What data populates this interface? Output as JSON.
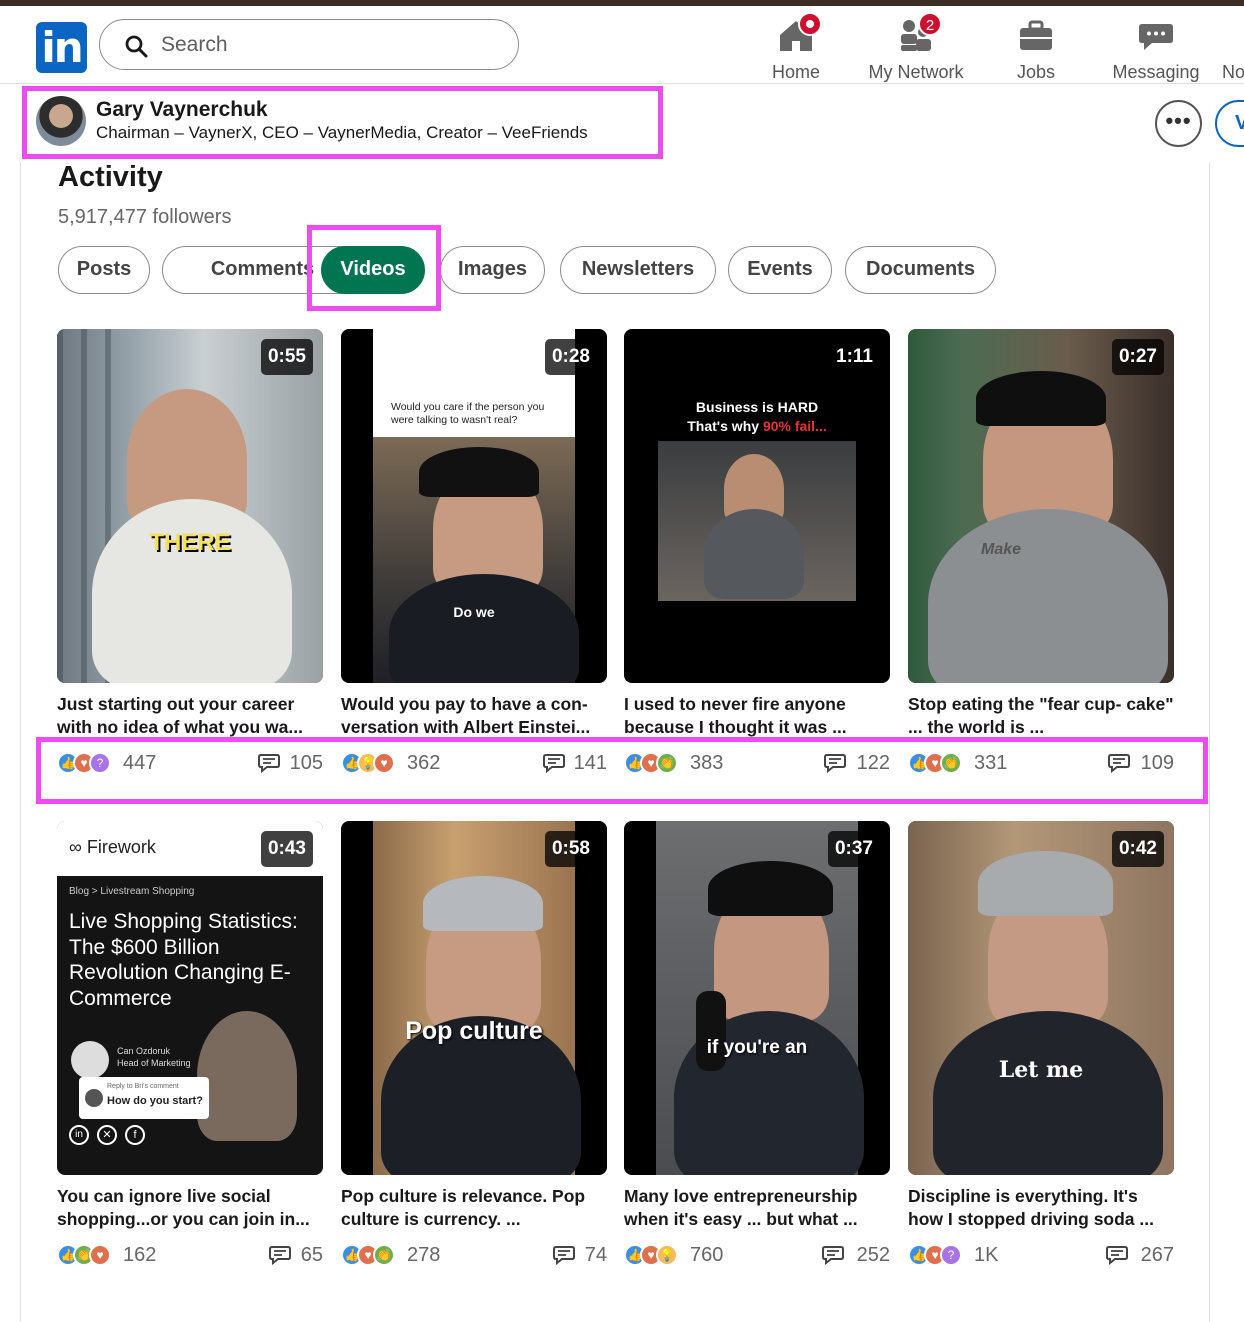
{
  "nav": {
    "logo": "in",
    "search_placeholder": "Search",
    "items": [
      {
        "label": "Home",
        "badge": ""
      },
      {
        "label": "My Network",
        "badge": "2"
      },
      {
        "label": "Jobs",
        "badge": ""
      },
      {
        "label": "Messaging",
        "badge": ""
      },
      {
        "label": "No",
        "badge": ""
      }
    ]
  },
  "profile": {
    "name": "Gary Vaynerchuk",
    "headline": "Chairman – VaynerX, CEO – VaynerMedia, Creator – VeeFriends",
    "more_label": "•••",
    "action_label": "V"
  },
  "activity": {
    "title": "Activity",
    "followers": "5,917,477 followers",
    "tabs": [
      "Posts",
      "Comments",
      "Videos",
      "Images",
      "Newsletters",
      "Events",
      "Documents"
    ],
    "active_tab": "Videos"
  },
  "videos": [
    {
      "duration": "0:55",
      "title": "Just starting out your career with no idea of what you wa...",
      "reactions": "447",
      "comments": "105",
      "overlay": "THERE",
      "reaction_types": [
        "like",
        "love",
        "curious"
      ]
    },
    {
      "duration": "0:28",
      "title": "Would you pay to have a con- versation with Albert Einstei...",
      "reactions": "362",
      "comments": "141",
      "overlay": "Do we",
      "caption_top": "Would you care if the person you were talking to wasn't real?",
      "reaction_types": [
        "like",
        "insight",
        "love"
      ]
    },
    {
      "duration": "1:11",
      "title": "I used to never fire anyone because I thought it was ...",
      "reactions": "383",
      "comments": "122",
      "caption_top": "Business is HARD",
      "caption_top2": "That's why ",
      "caption_red": "90% fail...",
      "reaction_types": [
        "like",
        "love",
        "celebrate"
      ]
    },
    {
      "duration": "0:27",
      "title": "Stop eating the \"fear cup- cake\" ... the world is ...",
      "reactions": "331",
      "comments": "109",
      "overlay": "Make",
      "reaction_types": [
        "like",
        "love",
        "celebrate"
      ]
    },
    {
      "duration": "0:43",
      "title": "You can ignore live social shopping...or you can join in...",
      "reactions": "162",
      "comments": "65",
      "fw_logo": "Firework",
      "fw_crumb": "Blog  >  Livestream Shopping",
      "fw_title": "Live Shopping Statistics: The $600 Billion Revolution Changing E-Commerce",
      "fw_author": "Can Ozdoruk",
      "fw_role": "Head of Marketing",
      "fw_reply": "Reply to Bri's comment",
      "fw_question": "How do you start?",
      "reaction_types": [
        "like",
        "celebrate",
        "love"
      ]
    },
    {
      "duration": "0:58",
      "title": "Pop culture is relevance. Pop culture is currency. ...",
      "reactions": "278",
      "comments": "74",
      "overlay": "Pop culture",
      "reaction_types": [
        "like",
        "love",
        "celebrate"
      ]
    },
    {
      "duration": "0:37",
      "title": "Many love entrepreneurship when it's easy ... but what ...",
      "reactions": "760",
      "comments": "252",
      "overlay": "if you're an",
      "reaction_types": [
        "like",
        "love",
        "insight"
      ]
    },
    {
      "duration": "0:42",
      "title": "Discipline is everything. It's how I stopped driving soda ...",
      "reactions": "1K",
      "comments": "267",
      "overlay": "Let me",
      "reaction_types": [
        "like",
        "love",
        "curious"
      ]
    }
  ],
  "colors": {
    "linkedin_blue": "#0a66c2",
    "active_tab_green": "#01754f",
    "highlight_magenta": "#ee4cf0",
    "badge_red": "#cb112d"
  }
}
